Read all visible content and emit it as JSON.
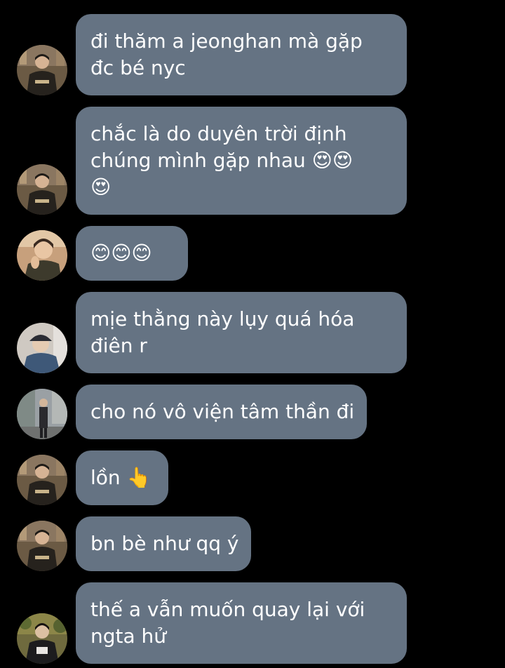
{
  "messages": [
    {
      "avatar": "avatar-a",
      "lines": [
        "đi thăm a jeonghan mà gặp",
        "đc bé nyc"
      ]
    },
    {
      "avatar": "avatar-a",
      "lines": [
        "chắc là do duyên trời định",
        "chúng mình gặp nhau 😍😍",
        "😍"
      ]
    },
    {
      "avatar": "avatar-b",
      "lines": [
        "😊😊😊"
      ]
    },
    {
      "avatar": "avatar-c",
      "lines": [
        "mịe thằng này lụy quá hóa",
        "điên r"
      ]
    },
    {
      "avatar": "avatar-d",
      "lines": [
        "cho nó vô viện tâm thần đi"
      ]
    },
    {
      "avatar": "avatar-a",
      "lines": [
        "lồn 👆"
      ]
    },
    {
      "avatar": "avatar-a",
      "lines": [
        "bn bè như qq ý"
      ]
    },
    {
      "avatar": "avatar-e",
      "lines": [
        "thế a vẫn muốn quay lại với",
        "ngta hử"
      ]
    }
  ],
  "colors": {
    "background": "#000000",
    "bubble": "#657383",
    "text": "#ffffff"
  }
}
